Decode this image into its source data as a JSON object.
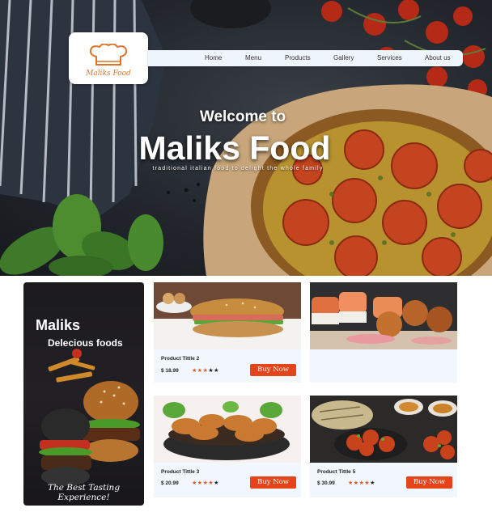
{
  "brand": {
    "name": "Maliks Food"
  },
  "nav": {
    "items": [
      "Home",
      "Menu",
      "Products",
      "Gallery",
      "Services",
      "About us"
    ]
  },
  "hero": {
    "welcome": "Welcome to",
    "title": "Maliks Food",
    "tagline": "traditional italian food to delight the whole family"
  },
  "promo": {
    "title": "Maliks",
    "subtitle": "Delecious foods",
    "footer": "The Best Tasting Experience!"
  },
  "products": [
    {
      "name": "Product Tittle 2",
      "price": "$ 18.99",
      "rating": 3,
      "max": 5,
      "button": "Buy Now",
      "image": "sandwich"
    },
    {
      "name": "",
      "price": "",
      "rating": 0,
      "max": 0,
      "button": "",
      "image": "sushi"
    },
    {
      "name": "Product Tittle 3",
      "price": "$ 20.99",
      "rating": 4,
      "max": 5,
      "button": "Buy Now",
      "image": "fried-chicken"
    },
    {
      "name": "Product Tittle 5",
      "price": "$ 30.99",
      "rating": 4,
      "max": 5,
      "button": "Buy Now",
      "image": "spicy-platter"
    }
  ],
  "colors": {
    "accent": "#e5441a",
    "card_bg": "#f1f7fd",
    "nav_bg": "#eef5fc",
    "logo": "#e0732a"
  }
}
